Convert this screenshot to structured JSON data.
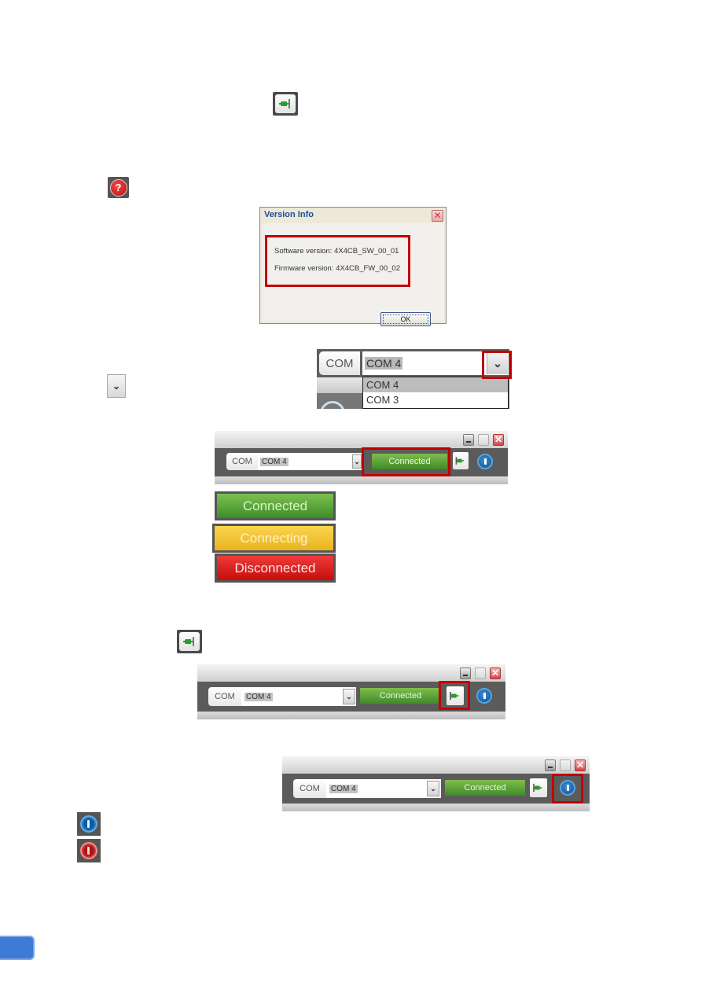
{
  "icons": {
    "connect_icon_top": "plug-connect-icon",
    "help_icon": "help-question-icon",
    "dropdown_icon": "chevron-down-icon",
    "connect_icon_mid": "plug-connect-icon",
    "power_blue": "power-on-icon",
    "power_red": "power-off-icon",
    "help_glyph": "?",
    "chevron_glyph": "⌄"
  },
  "version_dialog": {
    "title": "Version Info",
    "close_glyph": "✕",
    "software_line": "Software version: 4X4CB_SW_00_01",
    "firmware_line": "Firmware version: 4X4CB_FW_00_02",
    "ok_label": "OK"
  },
  "com_dropdown": {
    "label": "COM",
    "selected": "COM 4",
    "arrow_glyph": "⌄",
    "options": [
      "COM 4",
      "COM 3"
    ]
  },
  "toolbars": [
    {
      "com_label": "COM",
      "selected": "COM 4",
      "arrow_glyph": "⌄",
      "status": "Connected",
      "close_glyph": "✕",
      "highlight": "status"
    },
    {
      "com_label": "COM",
      "selected": "COM 4",
      "arrow_glyph": "⌄",
      "status": "Connected",
      "close_glyph": "✕",
      "highlight": "connect-button"
    },
    {
      "com_label": "COM",
      "selected": "COM 4",
      "arrow_glyph": "⌄",
      "status": "Connected",
      "close_glyph": "✕",
      "highlight": "power-button"
    }
  ],
  "status_states": [
    {
      "label": "Connected",
      "color": "#4f9a34"
    },
    {
      "label": "Connecting",
      "color": "#f2c233"
    },
    {
      "label": "Disconnected",
      "color": "#d91e1e"
    }
  ],
  "colors": {
    "highlight": "#c00000",
    "page_tab": "#3d7bd6"
  }
}
